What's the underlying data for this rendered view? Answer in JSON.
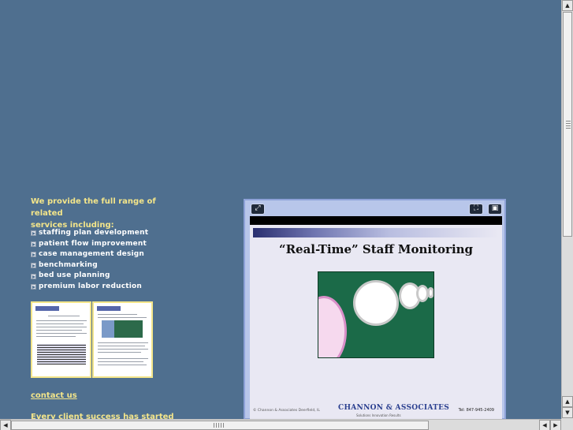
{
  "intro": {
    "line1": "We provide the full range of related",
    "line2": "services including:"
  },
  "services": [
    "staffing plan development",
    "patient flow improvement",
    "case management design",
    "benchmarking",
    "bed use planning",
    "premium labor reduction"
  ],
  "contact_link": "contact us",
  "tagline": "Every client success has started",
  "viewer": {
    "slide_title": "“Real-Time” Staff Monitoring",
    "footer_left": "© Channon & Associates  Deerfield, IL",
    "footer_logo": "CHANNON & ASSOCIATES",
    "footer_sub": "Solutions Innovation Results",
    "footer_right": "Tel: 847-945-2409"
  },
  "colors": {
    "background": "#4f6f8f",
    "accent_text": "#f3e58a",
    "viewer_frame": "#b8c6ea"
  },
  "icons": {
    "expand": "expand-icon",
    "fit": "fit-screen-icon",
    "window": "window-icon",
    "bullet": "arrow-bullet-icon"
  }
}
